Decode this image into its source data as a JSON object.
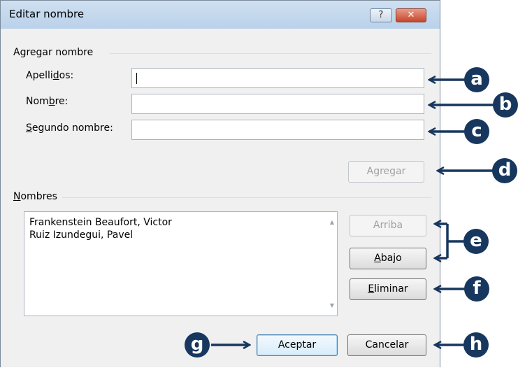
{
  "window": {
    "title": "Editar nombre",
    "help_glyph": "?",
    "close_glyph": "✕"
  },
  "add_group": {
    "label": "Agregar nombre",
    "apellidos_a": "Apelli",
    "apellidos_u": "d",
    "apellidos_b": "os:",
    "nombre_a": "Nom",
    "nombre_u": "b",
    "nombre_b": "re:",
    "segundo_u": "S",
    "segundo_b": "egundo nombre:",
    "apellidos_value": "",
    "nombre_value": "",
    "segundo_value": "",
    "agregar_button": "Agregar"
  },
  "names_group": {
    "label_u": "N",
    "label_b": "ombres",
    "items": [
      "Frankenstein Beaufort, Victor",
      "Ruiz Izundegui, Pavel"
    ],
    "arriba_button": "Arriba",
    "abajo_u": "A",
    "abajo_b": "bajo",
    "eliminar_u": "E",
    "eliminar_b": "liminar"
  },
  "footer": {
    "aceptar_button": "Aceptar",
    "cancelar_button": "Cancelar"
  },
  "callouts": {
    "a": "a",
    "b": "b",
    "c": "c",
    "d": "d",
    "e": "e",
    "f": "f",
    "g": "g",
    "h": "h"
  },
  "colors": {
    "callout": "#17375e",
    "dialog_bg": "#f0f0f0",
    "title_bar": "#c4d8ee"
  }
}
